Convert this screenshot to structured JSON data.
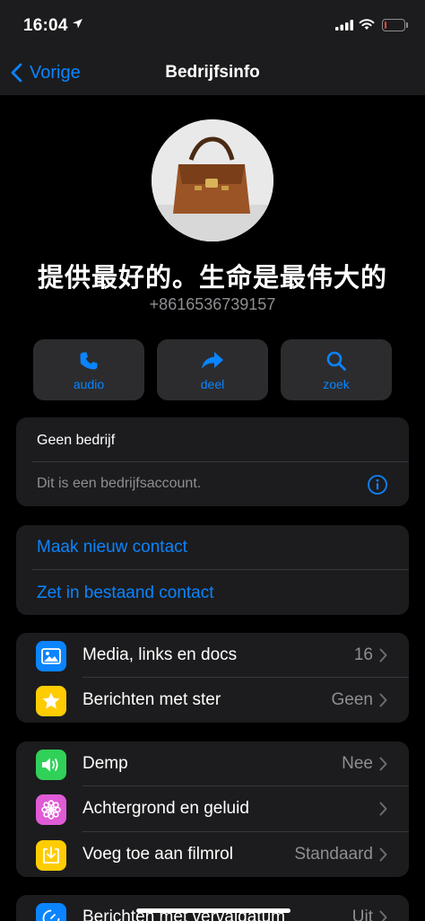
{
  "status": {
    "time": "16:04",
    "battery_level": 0.1
  },
  "nav": {
    "back_label": "Vorige",
    "title": "Bedrijfsinfo"
  },
  "profile": {
    "name": "提供最好的。生命是最伟大的",
    "phone": "+8616536739157"
  },
  "actions": [
    {
      "label": "audio",
      "icon": "phone-icon"
    },
    {
      "label": "deel",
      "icon": "share-icon"
    },
    {
      "label": "zoek",
      "icon": "search-icon"
    }
  ],
  "business": {
    "category": "Geen bedrijf",
    "note": "Dit is een bedrijfsaccount.",
    "info_icon": "info-icon"
  },
  "contact": {
    "new_contact": "Maak nieuw contact",
    "existing_contact": "Zet in bestaand contact"
  },
  "media_section": [
    {
      "label": "Media, links en docs",
      "value": "16",
      "icon": "photo-icon",
      "color": "#0a84ff"
    },
    {
      "label": "Berichten met ster",
      "value": "Geen",
      "icon": "star-icon",
      "color": "#ffcc00"
    }
  ],
  "settings_section": [
    {
      "label": "Demp",
      "value": "Nee",
      "icon": "speaker-icon",
      "color": "#30d158"
    },
    {
      "label": "Achtergrond en geluid",
      "value": "",
      "icon": "flower-icon",
      "color": "#e05bd5"
    },
    {
      "label": "Voeg toe aan filmrol",
      "value": "Standaard",
      "icon": "download-icon",
      "color": "#ffcc00"
    }
  ],
  "bottom_section": [
    {
      "label": "Berichten met vervaldatum",
      "value": "Uit",
      "icon": "timer-icon",
      "color": "#0a84ff"
    }
  ],
  "colors": {
    "accent": "#0a84ff",
    "background": "#000000",
    "card": "#1c1c1e"
  }
}
